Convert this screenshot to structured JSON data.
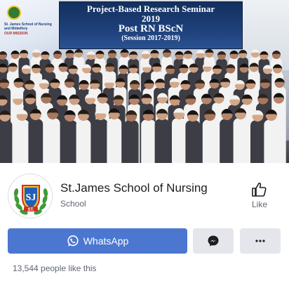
{
  "cover": {
    "banner_line1": "Project-Based Research Seminar",
    "banner_line2": "2019",
    "banner_line3": "Post RN BScN",
    "banner_line4": "(Session 2017-2019)",
    "side_poster_text": "St. James School of Nursing and Midwifery",
    "side_poster_caption": "OUR MISSION"
  },
  "profile": {
    "name": "St.James School of Nursing",
    "category": "School",
    "avatar_initials": "SJ",
    "avatar_small_text": "ST."
  },
  "like": {
    "label": "Like",
    "icon": "thumbs-up-icon"
  },
  "actions": {
    "whatsapp_label": "WhatsApp",
    "whatsapp_icon": "whatsapp-icon",
    "messenger_icon": "messenger-icon",
    "more_icon": "more-dots-icon"
  },
  "stats": {
    "likes_text": "13,544 people like this"
  },
  "colors": {
    "primary_button": "#4b77d1",
    "secondary_button": "#e4e6eb",
    "secondary_text": "#606770",
    "banner_blue": "#1d3f78"
  }
}
